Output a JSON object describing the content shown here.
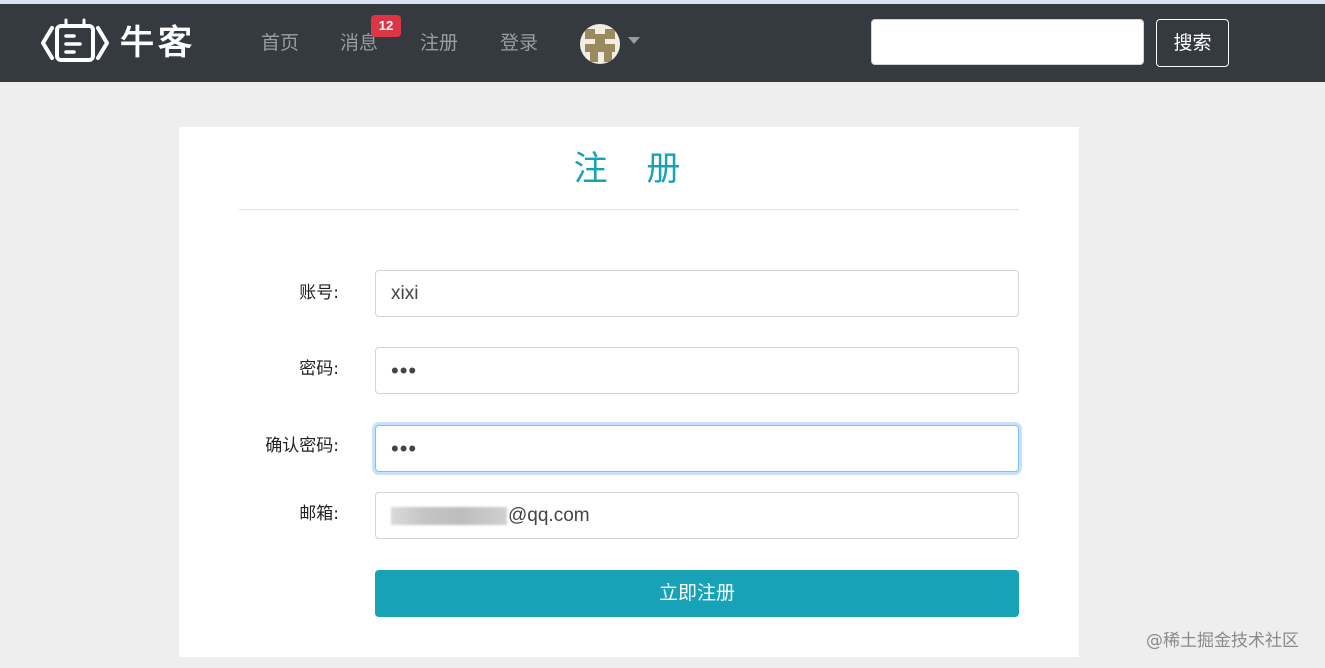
{
  "navbar": {
    "logo_text": "牛客",
    "links": [
      {
        "label": "首页"
      },
      {
        "label": "消息"
      },
      {
        "label": "注册"
      },
      {
        "label": "登录"
      }
    ],
    "message_badge": "12",
    "search": {
      "value": "",
      "button_label": "搜索"
    }
  },
  "form": {
    "title": "注 册",
    "fields": [
      {
        "label": "账号:",
        "value": "xixi"
      },
      {
        "label": "密码:",
        "value": "•••"
      },
      {
        "label": "确认密码:",
        "value": "•••"
      },
      {
        "label": "邮箱:",
        "value": "@qq.com"
      }
    ],
    "submit_label": "立即注册"
  },
  "watermark": "@稀土掘金技术社区",
  "colors": {
    "navbar_bg": "#343a40",
    "accent": "#17a2b8",
    "badge": "#dc3545",
    "page_bg": "#eeeeee"
  }
}
